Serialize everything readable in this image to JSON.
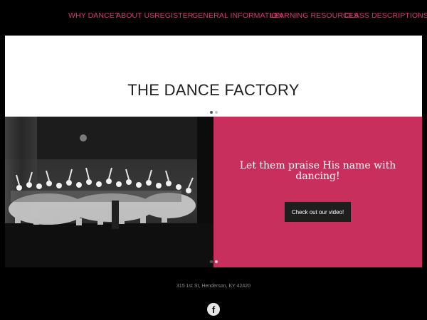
{
  "nav": {
    "items": [
      {
        "label": "WHY DANCE?"
      },
      {
        "label": "ABOUT US"
      },
      {
        "label": "REGISTER"
      },
      {
        "label": "GENERAL INFORMATION"
      },
      {
        "label": "LEARNING RESOURCES"
      },
      {
        "label": "CLASS DESCRIPTIONS"
      }
    ]
  },
  "hero": {
    "title": "THE DANCE FACTORY"
  },
  "slide": {
    "tagline": "Let them praise His name with dancing!",
    "button_label": "Check out our video!"
  },
  "footer": {
    "address": "315 1st St, Henderson, KY 42420",
    "social_icon": "facebook-icon",
    "social_glyph": "f"
  },
  "colors": {
    "accent": "#d63a71",
    "panel": "#c92f5c",
    "background": "#000000",
    "button": "#1e1e1e"
  },
  "pager": {
    "slide_count": 2,
    "active_index": 0
  }
}
